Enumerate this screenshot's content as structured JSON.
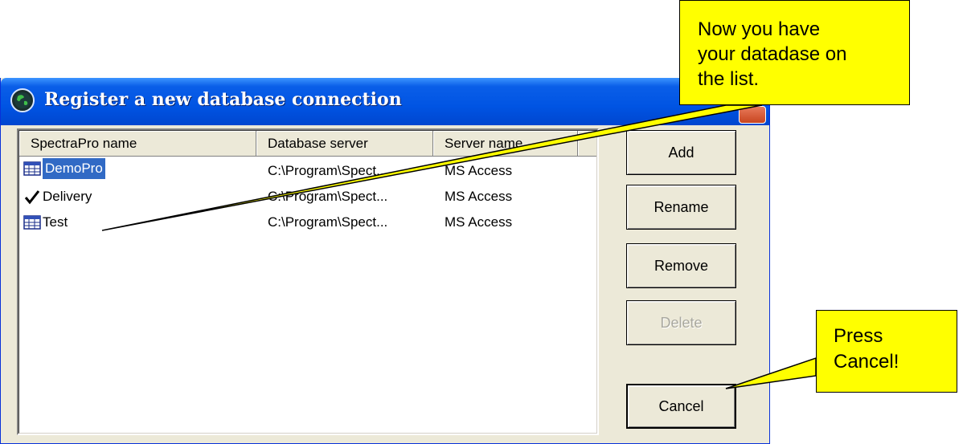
{
  "window": {
    "title": "Register a new database connection"
  },
  "list": {
    "columns": [
      "SpectraPro name",
      "Database server",
      "Server name",
      ""
    ],
    "rows": [
      {
        "name": "DemoPro",
        "db": "C:\\Program\\Spect...",
        "server": "MS Access",
        "icon": "table-icon",
        "selected": true
      },
      {
        "name": "Delivery",
        "db": "C:\\Program\\Spect...",
        "server": "MS Access",
        "icon": "checkmark-icon",
        "selected": false
      },
      {
        "name": "Test",
        "db": "C:\\Program\\Spect...",
        "server": "MS Access",
        "icon": "table-icon",
        "selected": false
      }
    ]
  },
  "buttons": {
    "add": "Add",
    "rename": "Rename",
    "remove": "Remove",
    "delete": "Delete",
    "cancel": "Cancel"
  },
  "callouts": {
    "top": [
      "Now you have",
      "your datadase on",
      "the list."
    ],
    "bottom": [
      "Press",
      "Cancel!"
    ]
  },
  "colors": {
    "titlebar": "#0054e3",
    "selection": "#316ac5",
    "callout": "#ffff00",
    "dialog_bg": "#ece9d8"
  }
}
